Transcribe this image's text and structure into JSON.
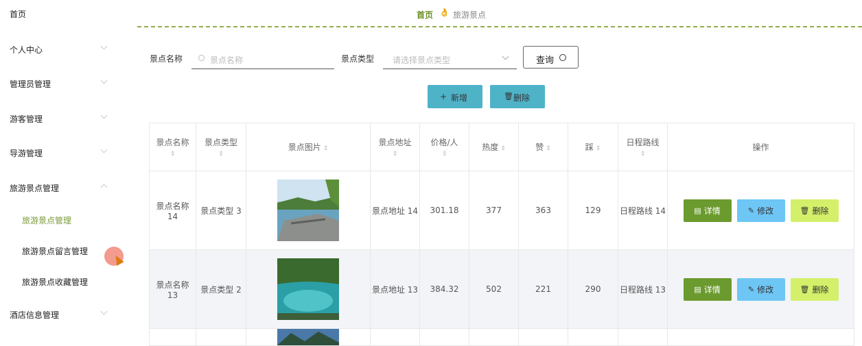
{
  "sidebar": {
    "items": [
      {
        "label": "首页"
      },
      {
        "label": "个人中心"
      },
      {
        "label": "管理员管理"
      },
      {
        "label": "游客管理"
      },
      {
        "label": "导游管理"
      },
      {
        "label": "旅游景点管理"
      },
      {
        "label": "酒店信息管理"
      }
    ],
    "subitems": [
      {
        "label": "旅游景点管理"
      },
      {
        "label": "旅游景点留言管理"
      },
      {
        "label": "旅游景点收藏管理"
      }
    ]
  },
  "breadcrumb": {
    "home": "首页",
    "separator": "👌",
    "current": "旅游景点"
  },
  "search": {
    "name_label": "景点名称",
    "name_placeholder": "景点名称",
    "type_label": "景点类型",
    "type_placeholder": "请选择景点类型",
    "button_label": "查询"
  },
  "toolbar": {
    "add_label": "新增",
    "delete_label": "删除"
  },
  "table": {
    "headers": [
      "景点名称",
      "景点类型",
      "景点图片",
      "景点地址",
      "价格/人",
      "热度",
      "赞",
      "踩",
      "日程路线",
      "操作"
    ],
    "rows": [
      {
        "name": "景点名称 14",
        "type": "景点类型 3",
        "address": "景点地址 14",
        "price": "301.18",
        "heat": "377",
        "likes": "363",
        "dislikes": "129",
        "route": "日程路线 14"
      },
      {
        "name": "景点名称 13",
        "type": "景点类型 2",
        "address": "景点地址 13",
        "price": "384.32",
        "heat": "502",
        "likes": "221",
        "dislikes": "290",
        "route": "日程路线 13"
      }
    ],
    "actions": {
      "detail": "详情",
      "edit": "修改",
      "delete": "删除"
    }
  },
  "colors": {
    "accent": "#6b8e23",
    "teal": "#4fb3c8",
    "detail": "#6b9a2e",
    "edit": "#6ec6f5",
    "remove": "#d4f06a"
  },
  "icons": [
    "chevron-down-icon",
    "chevron-up-icon",
    "search-icon",
    "plus-icon",
    "trash-icon",
    "document-icon",
    "pencil-icon"
  ]
}
